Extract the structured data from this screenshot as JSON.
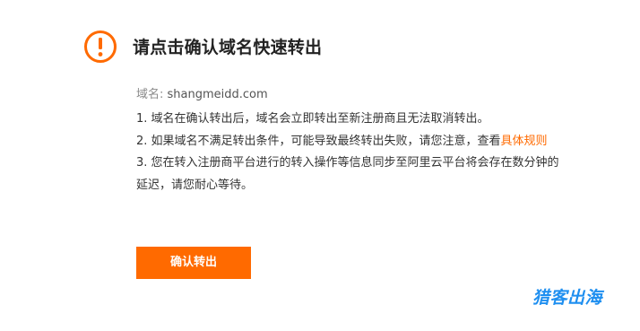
{
  "dialog": {
    "title": "请点击确认域名快速转出",
    "domain_label": "域名:",
    "domain_value": "shangmeidd.com",
    "notes": {
      "line1": "1. 域名在确认转出后，域名会立即转出至新注册商且无法取消转出。",
      "line2_prefix": "2. 如果域名不满足转出条件，可能导致最终转出失败，请您注意，查看",
      "line2_link": "具体规则",
      "line3a": "3. 您在转入注册商平台进行的转入操作等信息同步至阿里云平台将会存在数分钟的",
      "line3b": "延迟，请您耐心等待。"
    },
    "confirm_button": "确认转出"
  },
  "watermark": "猎客出海",
  "colors": {
    "accent": "#ff6a00",
    "watermark": "#1f8ff0",
    "title": "#222222",
    "text": "#333333",
    "muted": "#8a8a8a"
  },
  "icons": {
    "warning": "exclamation-circle-icon"
  }
}
